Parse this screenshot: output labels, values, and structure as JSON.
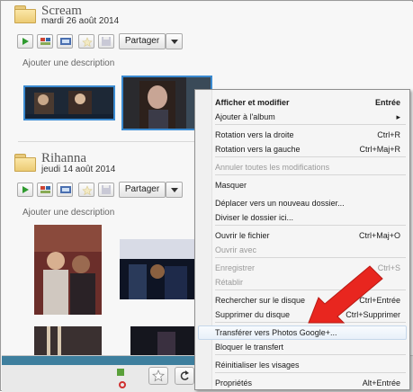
{
  "albums": [
    {
      "title": "Scream",
      "date": "mardi 26 août 2014",
      "share_label": "Partager",
      "description_placeholder": "Ajouter une description"
    },
    {
      "title": "Rihanna",
      "date": "jeudi 14 août 2014",
      "share_label": "Partager",
      "description_placeholder": "Ajouter une description"
    }
  ],
  "context_menu": {
    "items": [
      {
        "label": "Afficher et modifier",
        "shortcut": "Entrée"
      },
      {
        "label": "Ajouter à l'album",
        "shortcut": "▸"
      },
      {
        "label": "Rotation vers la droite",
        "shortcut": "Ctrl+R"
      },
      {
        "label": "Rotation vers la gauche",
        "shortcut": "Ctrl+Maj+R"
      },
      {
        "label": "Annuler toutes les modifications",
        "shortcut": ""
      },
      {
        "label": "Masquer",
        "shortcut": ""
      },
      {
        "label": "Déplacer vers un nouveau dossier...",
        "shortcut": ""
      },
      {
        "label": "Diviser le dossier ici...",
        "shortcut": ""
      },
      {
        "label": "Ouvrir le fichier",
        "shortcut": "Ctrl+Maj+O"
      },
      {
        "label": "Ouvrir avec",
        "shortcut": ""
      },
      {
        "label": "Enregistrer",
        "shortcut": "Ctrl+S"
      },
      {
        "label": "Rétablir",
        "shortcut": ""
      },
      {
        "label": "Rechercher sur le disque",
        "shortcut": "Ctrl+Entrée"
      },
      {
        "label": "Supprimer du disque",
        "shortcut": "Ctrl+Supprimer"
      },
      {
        "label": "Transférer vers Photos Google+...",
        "shortcut": ""
      },
      {
        "label": "Bloquer le transfert",
        "shortcut": ""
      },
      {
        "label": "Réinitialiser les visages",
        "shortcut": ""
      },
      {
        "label": "Propriétés",
        "shortcut": "Alt+Entrée"
      }
    ]
  },
  "colors": {
    "annotation_arrow": "#e8261f",
    "menu_highlight": "#e8f0f9",
    "selection_border": "#3a8ad0"
  }
}
